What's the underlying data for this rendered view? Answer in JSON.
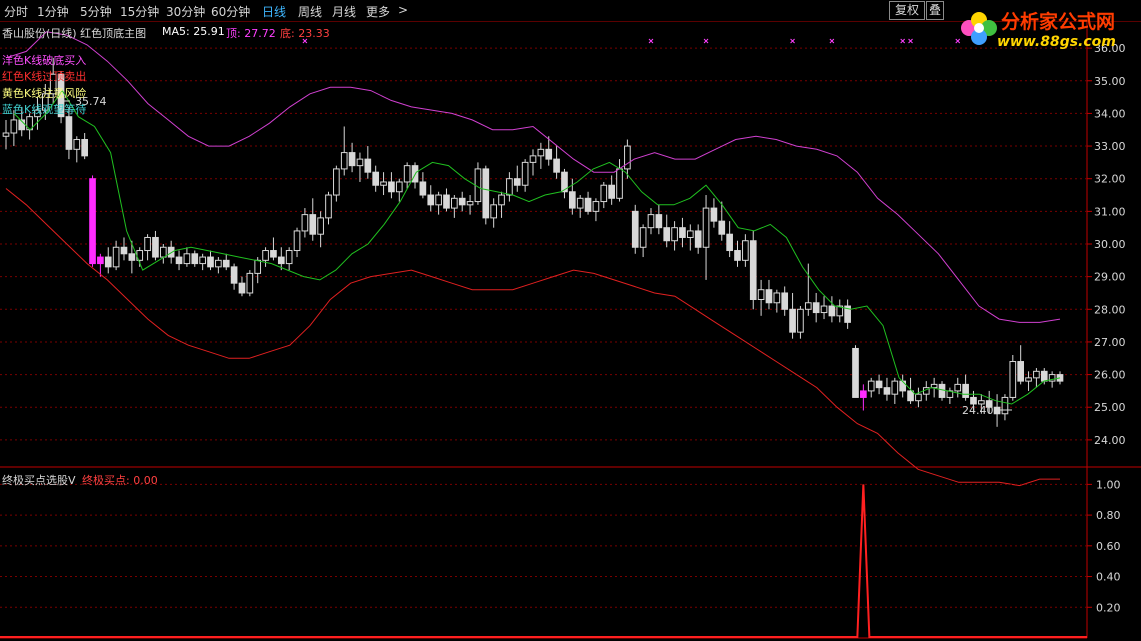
{
  "toolbar": {
    "periods": [
      "分时",
      "1分钟",
      "5分钟",
      "15分钟",
      "30分钟",
      "60分钟",
      "日线",
      "周线",
      "月线",
      "更多"
    ],
    "active_index": 6,
    "more_arrow": ">",
    "fuquan_label": "复权",
    "second_label": "叠"
  },
  "logo": {
    "title": "分析家公式网",
    "url": "www.88gs.com"
  },
  "main_header": {
    "title": "香山股份(日线) 红色顶底主图",
    "ma5_label": "MA5: 25.91",
    "top_label": "顶: 27.72",
    "bottom_label": "底: 23.33"
  },
  "legend": [
    {
      "text": "洋色K线破底买入",
      "color": "#ff4fff"
    },
    {
      "text": "红色K线过顶卖出",
      "color": "#ff3030"
    },
    {
      "text": "黄色K线注意风险",
      "color": "#ffff80"
    },
    {
      "text": "蓝色K线观望等待",
      "color": "#40d0d0"
    }
  ],
  "annotations": {
    "high_label": "35.74",
    "low_label": "24.40"
  },
  "sub_header": {
    "title": "终极买点选股V",
    "value_label": "终极买点: 0.00"
  },
  "colors": {
    "background": "#000000",
    "grid": "#7a0000",
    "axis": "#c00000",
    "candle": "#d8d8d8",
    "magenta_candle": "#ff2cff",
    "ma5": "#20c020",
    "top_band": "#d040d0",
    "bottom_band": "#e02020",
    "signal": "#ff2020",
    "active_tab": "#3fb7ff"
  },
  "chart_data": [
    {
      "type": "candlestick",
      "title": "香山股份(日线) 红色顶底主图",
      "ylim": [
        23.2,
        36.8
      ],
      "y_ticks": [
        "36.00",
        "35.00",
        "34.00",
        "33.00",
        "32.00",
        "31.00",
        "30.00",
        "29.00",
        "28.00",
        "27.00",
        "26.00",
        "25.00",
        "24.00"
      ],
      "candles": [
        [
          33.3,
          33.8,
          32.9,
          33.4
        ],
        [
          33.4,
          34.1,
          33.0,
          33.8
        ],
        [
          33.8,
          34.2,
          33.3,
          33.5
        ],
        [
          33.5,
          34.0,
          33.2,
          33.9
        ],
        [
          33.9,
          34.5,
          33.5,
          34.1
        ],
        [
          34.1,
          34.9,
          33.8,
          34.6
        ],
        [
          34.6,
          35.7,
          34.3,
          35.2
        ],
        [
          35.2,
          35.3,
          33.7,
          33.9
        ],
        [
          33.9,
          34.2,
          32.6,
          32.9
        ],
        [
          32.9,
          33.3,
          32.5,
          33.2
        ],
        [
          33.2,
          33.4,
          32.6,
          32.7
        ],
        [
          32.0,
          32.1,
          29.3,
          29.4
        ],
        [
          29.4,
          29.7,
          29.0,
          29.6
        ],
        [
          29.6,
          29.9,
          29.1,
          29.3
        ],
        [
          29.3,
          30.1,
          29.2,
          29.9
        ],
        [
          29.9,
          30.2,
          29.5,
          29.7
        ],
        [
          29.7,
          30.1,
          29.1,
          29.5
        ],
        [
          29.5,
          29.9,
          29.3,
          29.8
        ],
        [
          29.8,
          30.3,
          29.5,
          30.2
        ],
        [
          30.2,
          30.4,
          29.5,
          29.6
        ],
        [
          29.6,
          30.0,
          29.4,
          29.9
        ],
        [
          29.9,
          30.1,
          29.4,
          29.6
        ],
        [
          29.6,
          29.8,
          29.2,
          29.4
        ],
        [
          29.4,
          29.9,
          29.3,
          29.7
        ],
        [
          29.7,
          29.8,
          29.3,
          29.4
        ],
        [
          29.4,
          29.7,
          29.2,
          29.6
        ],
        [
          29.6,
          29.8,
          29.2,
          29.3
        ],
        [
          29.3,
          29.6,
          29.1,
          29.5
        ],
        [
          29.5,
          29.7,
          29.2,
          29.3
        ],
        [
          29.3,
          29.4,
          28.6,
          28.8
        ],
        [
          28.8,
          29.0,
          28.4,
          28.5
        ],
        [
          28.5,
          29.2,
          28.4,
          29.1
        ],
        [
          29.1,
          29.6,
          28.8,
          29.5
        ],
        [
          29.5,
          29.9,
          29.3,
          29.8
        ],
        [
          29.8,
          30.2,
          29.5,
          29.6
        ],
        [
          29.6,
          29.9,
          29.2,
          29.4
        ],
        [
          29.4,
          29.9,
          29.2,
          29.8
        ],
        [
          29.8,
          30.5,
          29.6,
          30.4
        ],
        [
          30.4,
          31.1,
          30.2,
          30.9
        ],
        [
          30.9,
          31.4,
          30.1,
          30.3
        ],
        [
          30.3,
          31.0,
          29.9,
          30.8
        ],
        [
          30.8,
          31.6,
          30.6,
          31.5
        ],
        [
          31.5,
          32.4,
          31.3,
          32.3
        ],
        [
          32.3,
          33.6,
          32.1,
          32.8
        ],
        [
          32.8,
          33.1,
          32.2,
          32.4
        ],
        [
          32.4,
          32.8,
          31.9,
          32.6
        ],
        [
          32.6,
          33.0,
          32.0,
          32.2
        ],
        [
          32.2,
          32.4,
          31.6,
          31.8
        ],
        [
          31.8,
          32.2,
          31.5,
          31.9
        ],
        [
          31.9,
          32.2,
          31.4,
          31.6
        ],
        [
          31.6,
          32.0,
          31.3,
          31.9
        ],
        [
          31.9,
          32.5,
          31.7,
          32.4
        ],
        [
          32.4,
          32.5,
          31.7,
          31.9
        ],
        [
          31.9,
          32.2,
          31.4,
          31.5
        ],
        [
          31.5,
          31.8,
          31.0,
          31.2
        ],
        [
          31.2,
          31.6,
          30.9,
          31.5
        ],
        [
          31.5,
          31.7,
          31.0,
          31.1
        ],
        [
          31.1,
          31.5,
          30.8,
          31.4
        ],
        [
          31.4,
          31.6,
          31.0,
          31.2
        ],
        [
          31.2,
          31.5,
          30.9,
          31.3
        ],
        [
          31.3,
          32.5,
          31.2,
          32.3
        ],
        [
          32.3,
          32.4,
          30.6,
          30.8
        ],
        [
          30.8,
          31.4,
          30.5,
          31.2
        ],
        [
          31.2,
          31.6,
          30.8,
          31.5
        ],
        [
          31.5,
          32.2,
          31.3,
          32.0
        ],
        [
          32.0,
          32.4,
          31.6,
          31.8
        ],
        [
          31.8,
          32.6,
          31.6,
          32.5
        ],
        [
          32.5,
          32.9,
          32.1,
          32.7
        ],
        [
          32.7,
          33.1,
          32.3,
          32.9
        ],
        [
          32.9,
          33.3,
          32.4,
          32.6
        ],
        [
          32.6,
          33.0,
          32.0,
          32.2
        ],
        [
          32.2,
          32.3,
          31.4,
          31.6
        ],
        [
          31.6,
          32.0,
          30.9,
          31.1
        ],
        [
          31.1,
          31.5,
          30.8,
          31.4
        ],
        [
          31.4,
          31.6,
          30.9,
          31.0
        ],
        [
          31.0,
          31.4,
          30.7,
          31.3
        ],
        [
          31.3,
          31.9,
          31.1,
          31.8
        ],
        [
          31.8,
          32.1,
          31.2,
          31.4
        ],
        [
          31.4,
          32.6,
          31.3,
          32.3
        ],
        [
          32.3,
          33.2,
          32.0,
          33.0
        ],
        [
          31.0,
          31.2,
          29.7,
          29.9
        ],
        [
          29.9,
          30.6,
          29.6,
          30.5
        ],
        [
          30.5,
          31.1,
          30.3,
          30.9
        ],
        [
          30.9,
          31.2,
          30.3,
          30.5
        ],
        [
          30.5,
          30.9,
          29.9,
          30.1
        ],
        [
          30.1,
          30.7,
          29.8,
          30.5
        ],
        [
          30.5,
          30.8,
          29.9,
          30.2
        ],
        [
          30.2,
          30.6,
          29.8,
          30.4
        ],
        [
          30.4,
          30.6,
          29.7,
          29.9
        ],
        [
          29.9,
          31.5,
          28.9,
          31.1
        ],
        [
          31.1,
          31.4,
          30.5,
          30.7
        ],
        [
          30.7,
          31.3,
          30.1,
          30.3
        ],
        [
          30.3,
          30.7,
          29.6,
          29.8
        ],
        [
          29.8,
          30.1,
          29.3,
          29.5
        ],
        [
          29.5,
          30.3,
          29.3,
          30.1
        ],
        [
          30.1,
          30.4,
          28.0,
          28.3
        ],
        [
          28.3,
          28.9,
          27.8,
          28.6
        ],
        [
          28.6,
          28.9,
          28.0,
          28.2
        ],
        [
          28.2,
          28.6,
          27.9,
          28.5
        ],
        [
          28.5,
          28.7,
          27.8,
          28.0
        ],
        [
          28.0,
          28.5,
          27.1,
          27.3
        ],
        [
          27.3,
          28.1,
          27.1,
          28.0
        ],
        [
          28.0,
          29.4,
          27.8,
          28.2
        ],
        [
          28.2,
          28.5,
          27.6,
          27.9
        ],
        [
          27.9,
          28.4,
          27.7,
          28.1
        ],
        [
          28.1,
          28.4,
          27.6,
          27.8
        ],
        [
          27.8,
          28.3,
          27.6,
          28.1
        ],
        [
          28.1,
          28.3,
          27.4,
          27.6
        ],
        [
          26.8,
          26.9,
          25.3,
          25.3
        ],
        [
          25.3,
          25.7,
          24.9,
          25.5
        ],
        [
          25.5,
          25.9,
          25.3,
          25.8
        ],
        [
          25.8,
          26.0,
          25.4,
          25.6
        ],
        [
          25.6,
          25.9,
          25.2,
          25.4
        ],
        [
          25.4,
          25.9,
          25.1,
          25.8
        ],
        [
          25.8,
          26.0,
          25.3,
          25.5
        ],
        [
          25.5,
          25.9,
          25.1,
          25.2
        ],
        [
          25.2,
          25.6,
          25.0,
          25.4
        ],
        [
          25.4,
          25.8,
          25.2,
          25.6
        ],
        [
          25.6,
          25.9,
          25.3,
          25.7
        ],
        [
          25.7,
          25.8,
          25.2,
          25.3
        ],
        [
          25.3,
          25.6,
          25.1,
          25.5
        ],
        [
          25.5,
          25.9,
          25.3,
          25.7
        ],
        [
          25.7,
          26.0,
          25.2,
          25.3
        ],
        [
          25.3,
          25.5,
          24.9,
          25.1
        ],
        [
          25.1,
          25.4,
          24.8,
          25.2
        ],
        [
          25.2,
          25.5,
          24.8,
          25.0
        ],
        [
          25.0,
          25.4,
          24.4,
          24.8
        ],
        [
          24.8,
          25.4,
          24.6,
          25.3
        ],
        [
          25.3,
          26.6,
          25.2,
          26.4
        ],
        [
          26.4,
          26.9,
          25.7,
          25.8
        ],
        [
          25.8,
          26.1,
          25.5,
          25.9
        ],
        [
          25.9,
          26.2,
          25.6,
          26.1
        ],
        [
          26.1,
          26.2,
          25.7,
          25.8
        ],
        [
          25.8,
          26.1,
          25.6,
          26.0
        ],
        [
          26.0,
          26.1,
          25.7,
          25.8
        ]
      ],
      "magenta_indices": [
        11,
        12,
        109
      ],
      "top_band": [
        35.7,
        35.9,
        36.5,
        36.4,
        36.1,
        35.6,
        35.0,
        34.3,
        33.8,
        33.3,
        33.0,
        33.0,
        33.3,
        33.7,
        34.2,
        34.6,
        34.8,
        34.8,
        34.7,
        34.4,
        34.2,
        34.1,
        34.0,
        33.8,
        33.5,
        33.5,
        33.6,
        33.1,
        32.6,
        32.2,
        32.2,
        32.6,
        32.8,
        32.6,
        32.6,
        32.9,
        33.2,
        33.3,
        33.2,
        33.0,
        32.9,
        32.7,
        32.2,
        31.4,
        30.9,
        30.3,
        29.7,
        28.9,
        28.1,
        27.7,
        27.6,
        27.6,
        27.7
      ],
      "bottom_band": [
        31.7,
        31.2,
        30.6,
        30.0,
        29.4,
        28.9,
        28.3,
        27.7,
        27.2,
        26.9,
        26.7,
        26.5,
        26.5,
        26.7,
        26.9,
        27.5,
        28.3,
        28.8,
        29.0,
        29.1,
        29.2,
        29.0,
        28.8,
        28.6,
        28.6,
        28.6,
        28.8,
        29.0,
        29.2,
        29.1,
        28.9,
        28.7,
        28.5,
        28.4,
        28.0,
        27.6,
        27.2,
        26.8,
        26.4,
        26.0,
        25.6,
        25.0,
        24.5,
        24.2,
        23.6,
        23.1,
        22.9,
        22.7,
        22.7,
        22.7,
        22.6,
        22.8,
        22.8
      ],
      "ma5": [
        34.0,
        33.5,
        34.0,
        34.7,
        33.9,
        33.6,
        32.8,
        30.4,
        29.2,
        29.5,
        29.8,
        29.9,
        29.8,
        29.7,
        29.6,
        29.5,
        29.4,
        29.2,
        29.0,
        28.9,
        29.2,
        29.7,
        30.0,
        30.6,
        31.3,
        32.2,
        32.5,
        32.4,
        32.0,
        31.7,
        31.6,
        31.5,
        31.3,
        31.5,
        31.6,
        31.9,
        32.3,
        32.5,
        32.2,
        31.6,
        31.2,
        31.2,
        31.4,
        31.8,
        31.2,
        30.5,
        30.4,
        30.6,
        30.2,
        29.3,
        28.6,
        28.1,
        28.0,
        28.1,
        27.5,
        25.9,
        25.4,
        25.6,
        25.5,
        25.4,
        25.4,
        25.2,
        25.1,
        25.4,
        25.8,
        25.9
      ]
    },
    {
      "type": "line",
      "title": "终极买点选股V",
      "series": [
        {
          "name": "终极买点",
          "peak_index": 109,
          "peak_value": 1.0
        }
      ],
      "ylim": [
        0,
        1.1
      ],
      "y_ticks": [
        "1.00",
        "0.80",
        "0.60",
        "0.40",
        "0.20"
      ]
    }
  ]
}
